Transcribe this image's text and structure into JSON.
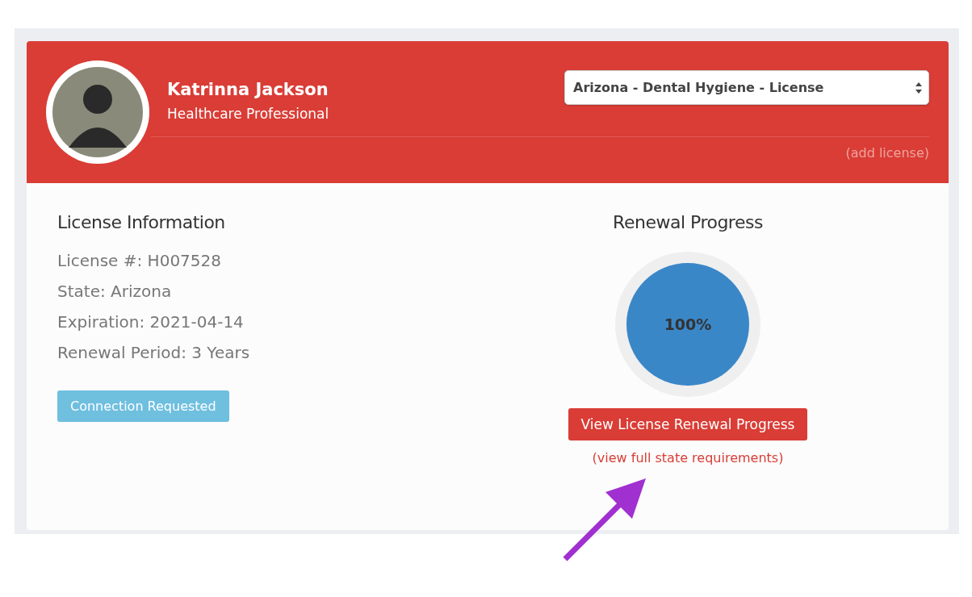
{
  "profile": {
    "name": "Katrinna Jackson",
    "role": "Healthcare Professional"
  },
  "license_select": {
    "value": "Arizona - Dental Hygiene - License"
  },
  "add_license_link": "(add license)",
  "license_info": {
    "title": "License Information",
    "lines": [
      "License #: H007528",
      "State: Arizona",
      "Expiration: 2021-04-14",
      "Renewal Period: 3 Years"
    ],
    "status_button": "Connection Requested"
  },
  "renewal": {
    "title": "Renewal Progress",
    "level": 1,
    "reading": "100%",
    "button": "View License Renewal Progress",
    "link": "(view full state requirements)"
  }
}
